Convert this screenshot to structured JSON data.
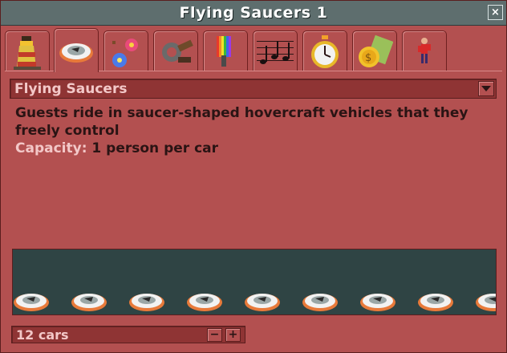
{
  "window": {
    "title": "Flying Saucers 1",
    "close_glyph": "×"
  },
  "tabs": [
    {
      "icon": "lighthouse-icon",
      "active": false
    },
    {
      "icon": "flying-saucer-vehicle-icon",
      "active": true
    },
    {
      "icon": "fireworks-icon",
      "active": false
    },
    {
      "icon": "wrench-icon",
      "active": false
    },
    {
      "icon": "paint-colours-icon",
      "active": false
    },
    {
      "icon": "music-notes-icon",
      "active": false
    },
    {
      "icon": "stopwatch-icon",
      "active": false
    },
    {
      "icon": "money-icon",
      "active": false
    },
    {
      "icon": "guest-icon",
      "active": false
    }
  ],
  "vehicle": {
    "selected": "Flying Saucers",
    "description": "Guests ride in saucer-shaped hovercraft vehicles that they freely control",
    "capacity_label": "Capacity:",
    "capacity_value": "1 person per car"
  },
  "preview": {
    "car_count_shown": 9
  },
  "count": {
    "value": "12 cars",
    "decrease": "−",
    "increase": "+"
  }
}
